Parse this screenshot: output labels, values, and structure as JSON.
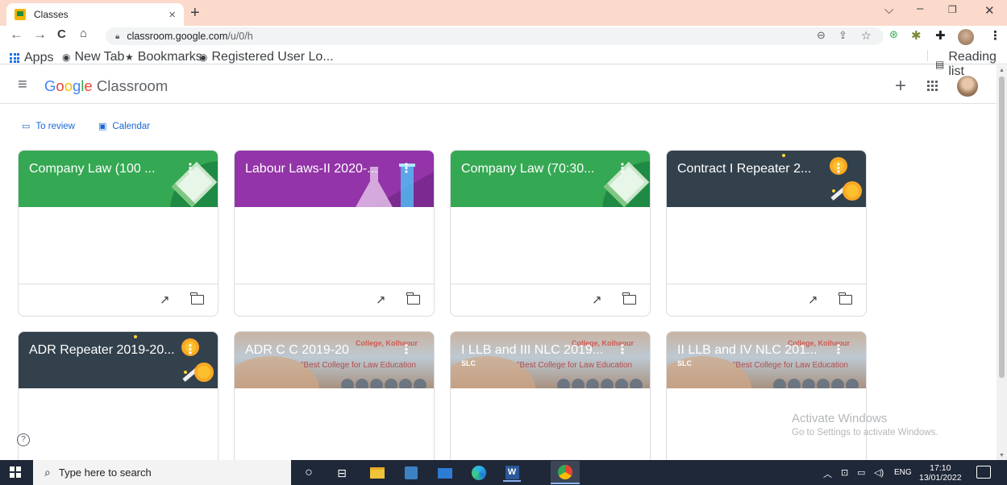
{
  "browser": {
    "tab_title": "Classes",
    "tab_close": "×",
    "new_tab": "+",
    "url_host": "classroom.google.com",
    "url_path": "/u/0/h",
    "bookmarks": [
      {
        "label": "Apps"
      },
      {
        "label": "New Tab"
      },
      {
        "label": "Bookmarks"
      },
      {
        "label": "Registered User Lo..."
      }
    ],
    "reading_list": "Reading list"
  },
  "app": {
    "logo_google": [
      "G",
      "o",
      "o",
      "g",
      "l",
      "e"
    ],
    "logo_product": " Classroom",
    "quick_links": [
      {
        "label": "To review",
        "icon": "to-review-icon"
      },
      {
        "label": "Calendar",
        "icon": "calendar-icon"
      }
    ]
  },
  "courses": [
    {
      "title": "Company Law (100 ...",
      "subtitle": "",
      "theme": "green",
      "art": "book"
    },
    {
      "title": "Labour Laws-II 2020-...",
      "subtitle": "",
      "theme": "purple",
      "art": "flask"
    },
    {
      "title": "Company Law (70:30...",
      "subtitle": "",
      "theme": "green",
      "art": "book"
    },
    {
      "title": "Contract I Repeater 2...",
      "subtitle": "",
      "theme": "dark",
      "art": "coins"
    },
    {
      "title": "ADR Repeater 2019-20...",
      "subtitle": "",
      "theme": "dark",
      "art": "coins"
    },
    {
      "title": "ADR C C 2019-20",
      "subtitle": "",
      "theme": "photo",
      "art": "college"
    },
    {
      "title": "I LLB and III NLC 2019...",
      "subtitle": "SLC",
      "theme": "photo",
      "art": "college"
    },
    {
      "title": "II LLB and IV NLC 201...",
      "subtitle": "SLC",
      "theme": "photo",
      "art": "college"
    }
  ],
  "college_banner": {
    "name_fragment": "College, Kolhapur",
    "tagline": "\"Best College for Law Education"
  },
  "watermark": {
    "line1": "Activate Windows",
    "line2": "Go to Settings to activate Windows."
  },
  "taskbar": {
    "search_placeholder": "Type here to search",
    "lang": "ENG",
    "time": "17:10",
    "date": "13/01/2022"
  },
  "colors": {
    "green": "#35a853",
    "purple": "#9334a8",
    "dark": "#33414c",
    "link_blue": "#1967d2",
    "tabstrip": "#fbd9cb"
  }
}
